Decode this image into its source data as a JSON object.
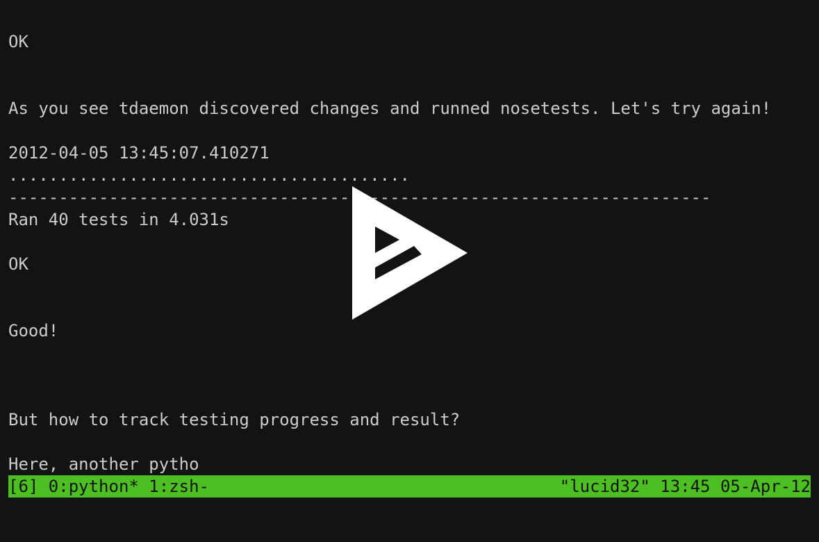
{
  "terminal": {
    "lines": [
      "OK",
      "As you see tdaemon discovered changes and runned nosetests. Let's try again!",
      "2012-04-05 13:45:07.410271",
      "........................................",
      "----------------------------------------------------------------------",
      "Ran 40 tests in 4.031s",
      "OK",
      "Good!",
      "But how to track testing progress and result?",
      "Here, another pytho"
    ]
  },
  "tmux_status": {
    "left": "[6] 0:python* 1:zsh-",
    "right": "\"lucid32\" 13:45 05-Apr-12",
    "color": "#4ebf22"
  },
  "player": {
    "overlay_icon": "asciinema-play-icon"
  }
}
